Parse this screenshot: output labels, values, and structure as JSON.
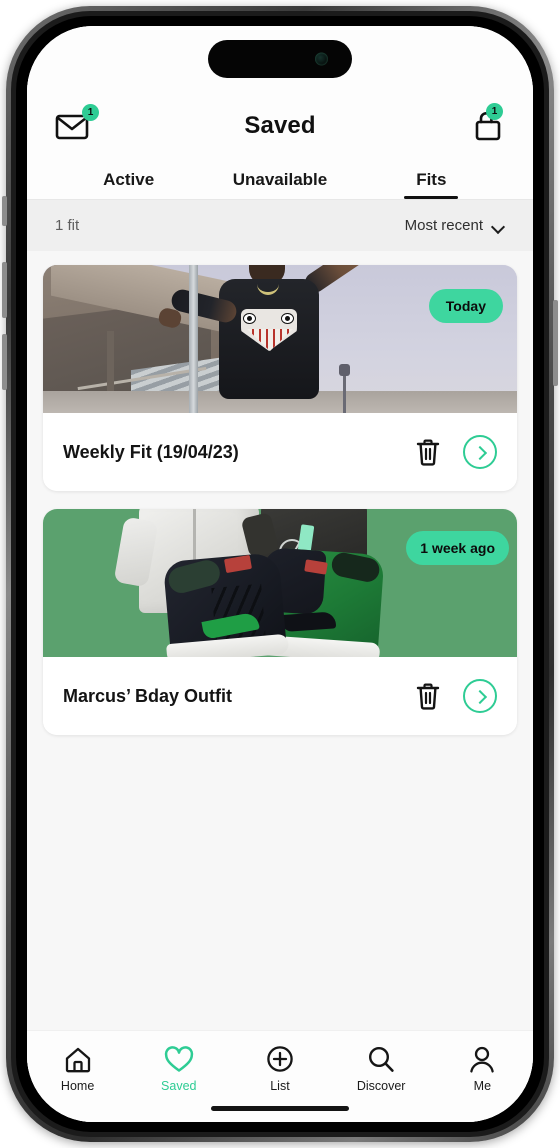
{
  "header": {
    "title": "Saved",
    "mail_icon": "envelope-icon",
    "mail_badge": "1",
    "bag_icon": "shopping-bag-icon",
    "bag_badge": "1"
  },
  "tabs": [
    {
      "label": "Active",
      "active": false
    },
    {
      "label": "Unavailable",
      "active": false
    },
    {
      "label": "Fits",
      "active": true
    }
  ],
  "filterbar": {
    "count_label": "1 fit",
    "sort_label": "Most recent",
    "sort_icon": "chevron-down-icon"
  },
  "cards": [
    {
      "title": "Weekly Fit (19/04/23)",
      "time_badge": "Today",
      "delete_icon": "trash-icon",
      "open_icon": "chevron-right-icon"
    },
    {
      "title": "Marcus’ Bday Outfit",
      "time_badge": "1 week ago",
      "delete_icon": "trash-icon",
      "open_icon": "chevron-right-icon"
    }
  ],
  "tabbar": [
    {
      "label": "Home",
      "icon": "home-icon",
      "active": false
    },
    {
      "label": "Saved",
      "icon": "heart-icon",
      "active": true
    },
    {
      "label": "List",
      "icon": "plus-circle-icon",
      "active": false
    },
    {
      "label": "Discover",
      "icon": "search-icon",
      "active": false
    },
    {
      "label": "Me",
      "icon": "person-icon",
      "active": false
    }
  ],
  "colors": {
    "accent_green": "#2ecc94",
    "badge_green": "#3ed69f",
    "card_green_bg": "#5ba16e",
    "text_dark": "#141414",
    "filter_bg": "#efefef"
  }
}
